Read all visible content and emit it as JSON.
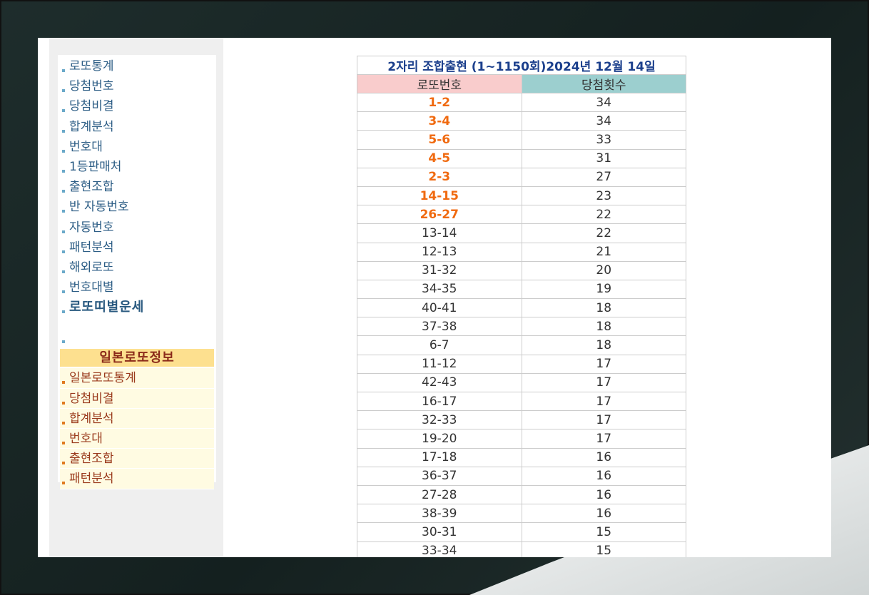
{
  "sidebar": {
    "items": [
      {
        "label": "로또통계",
        "bold": false
      },
      {
        "label": "당첨번호",
        "bold": false
      },
      {
        "label": "당첨비결",
        "bold": false
      },
      {
        "label": "합계분석",
        "bold": false
      },
      {
        "label": "번호대",
        "bold": false
      },
      {
        "label": "1등판매처",
        "bold": false
      },
      {
        "label": "출현조합",
        "bold": false
      },
      {
        "label": "반 자동번호",
        "bold": false
      },
      {
        "label": "자동번호",
        "bold": false
      },
      {
        "label": "패턴분석",
        "bold": false
      },
      {
        "label": "해외로또",
        "bold": false
      },
      {
        "label": "번호대별",
        "bold": false
      },
      {
        "label": "로또띠별운세",
        "bold": true
      },
      {
        "label": "",
        "bold": false
      }
    ],
    "japan_header": "일본로또정보",
    "japan_items": [
      "일본로또통계",
      "당첨비결",
      "합계분석",
      "번호대",
      "출현조합",
      "패턴분석"
    ]
  },
  "table": {
    "title": "2자리 조합출현 (1~1150회)2024년 12월 14일",
    "col_number": "로또번호",
    "col_count": "당첨횟수",
    "highlight_color": "#f06a10",
    "rows": [
      {
        "pair": "1-2",
        "count": "34",
        "hot": true
      },
      {
        "pair": "3-4",
        "count": "34",
        "hot": true
      },
      {
        "pair": "5-6",
        "count": "33",
        "hot": true
      },
      {
        "pair": "4-5",
        "count": "31",
        "hot": true
      },
      {
        "pair": "2-3",
        "count": "27",
        "hot": true
      },
      {
        "pair": "14-15",
        "count": "23",
        "hot": true
      },
      {
        "pair": "26-27",
        "count": "22",
        "hot": true
      },
      {
        "pair": "13-14",
        "count": "22",
        "hot": false
      },
      {
        "pair": "12-13",
        "count": "21",
        "hot": false
      },
      {
        "pair": "31-32",
        "count": "20",
        "hot": false
      },
      {
        "pair": "34-35",
        "count": "19",
        "hot": false
      },
      {
        "pair": "40-41",
        "count": "18",
        "hot": false
      },
      {
        "pair": "37-38",
        "count": "18",
        "hot": false
      },
      {
        "pair": "6-7",
        "count": "18",
        "hot": false
      },
      {
        "pair": "11-12",
        "count": "17",
        "hot": false
      },
      {
        "pair": "42-43",
        "count": "17",
        "hot": false
      },
      {
        "pair": "16-17",
        "count": "17",
        "hot": false
      },
      {
        "pair": "32-33",
        "count": "17",
        "hot": false
      },
      {
        "pair": "19-20",
        "count": "17",
        "hot": false
      },
      {
        "pair": "17-18",
        "count": "16",
        "hot": false
      },
      {
        "pair": "36-37",
        "count": "16",
        "hot": false
      },
      {
        "pair": "27-28",
        "count": "16",
        "hot": false
      },
      {
        "pair": "38-39",
        "count": "16",
        "hot": false
      },
      {
        "pair": "30-31",
        "count": "15",
        "hot": false
      },
      {
        "pair": "33-34",
        "count": "15",
        "hot": false
      }
    ]
  }
}
